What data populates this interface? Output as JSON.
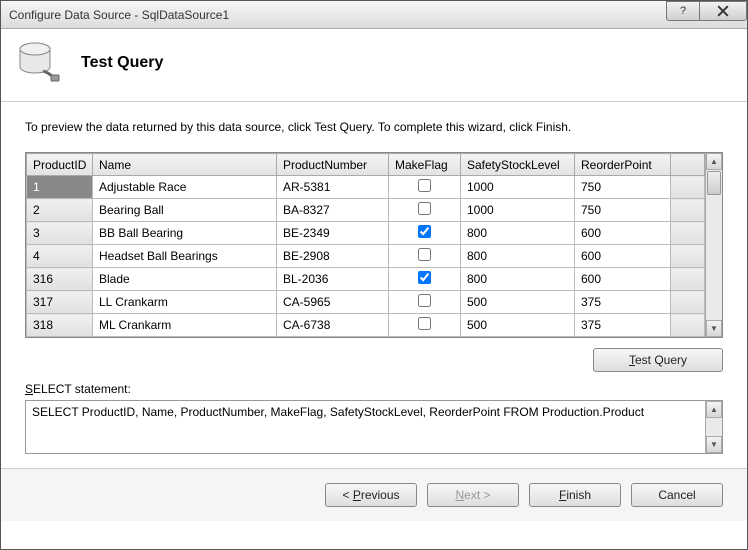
{
  "window": {
    "title": "Configure Data Source - SqlDataSource1"
  },
  "header": {
    "heading": "Test Query"
  },
  "instruction": "To preview the data returned by this data source, click Test Query. To complete this wizard, click Finish.",
  "grid": {
    "columns": [
      "ProductID",
      "Name",
      "ProductNumber",
      "MakeFlag",
      "SafetyStockLevel",
      "ReorderPoint"
    ],
    "rows": [
      {
        "ProductID": "1",
        "Name": "Adjustable Race",
        "ProductNumber": "AR-5381",
        "MakeFlag": false,
        "SafetyStockLevel": "1000",
        "ReorderPoint": "750",
        "selected": true
      },
      {
        "ProductID": "2",
        "Name": "Bearing Ball",
        "ProductNumber": "BA-8327",
        "MakeFlag": false,
        "SafetyStockLevel": "1000",
        "ReorderPoint": "750",
        "selected": false
      },
      {
        "ProductID": "3",
        "Name": "BB Ball Bearing",
        "ProductNumber": "BE-2349",
        "MakeFlag": true,
        "SafetyStockLevel": "800",
        "ReorderPoint": "600",
        "selected": false
      },
      {
        "ProductID": "4",
        "Name": "Headset Ball Bearings",
        "ProductNumber": "BE-2908",
        "MakeFlag": false,
        "SafetyStockLevel": "800",
        "ReorderPoint": "600",
        "selected": false
      },
      {
        "ProductID": "316",
        "Name": "Blade",
        "ProductNumber": "BL-2036",
        "MakeFlag": true,
        "SafetyStockLevel": "800",
        "ReorderPoint": "600",
        "selected": false
      },
      {
        "ProductID": "317",
        "Name": "LL Crankarm",
        "ProductNumber": "CA-5965",
        "MakeFlag": false,
        "SafetyStockLevel": "500",
        "ReorderPoint": "375",
        "selected": false
      },
      {
        "ProductID": "318",
        "Name": "ML Crankarm",
        "ProductNumber": "CA-6738",
        "MakeFlag": false,
        "SafetyStockLevel": "500",
        "ReorderPoint": "375",
        "selected": false
      }
    ]
  },
  "buttons": {
    "test_query": "Test Query",
    "previous": "< Previous",
    "next": "Next >",
    "finish": "Finish",
    "cancel": "Cancel"
  },
  "statement": {
    "label": "SELECT statement:",
    "text": "SELECT ProductID, Name, ProductNumber, MakeFlag, SafetyStockLevel, ReorderPoint FROM Production.Product"
  },
  "underlines": {
    "test_query_char": "T",
    "previous_char": "P",
    "next_char": "N",
    "finish_char": "F",
    "statement_char": "S"
  }
}
